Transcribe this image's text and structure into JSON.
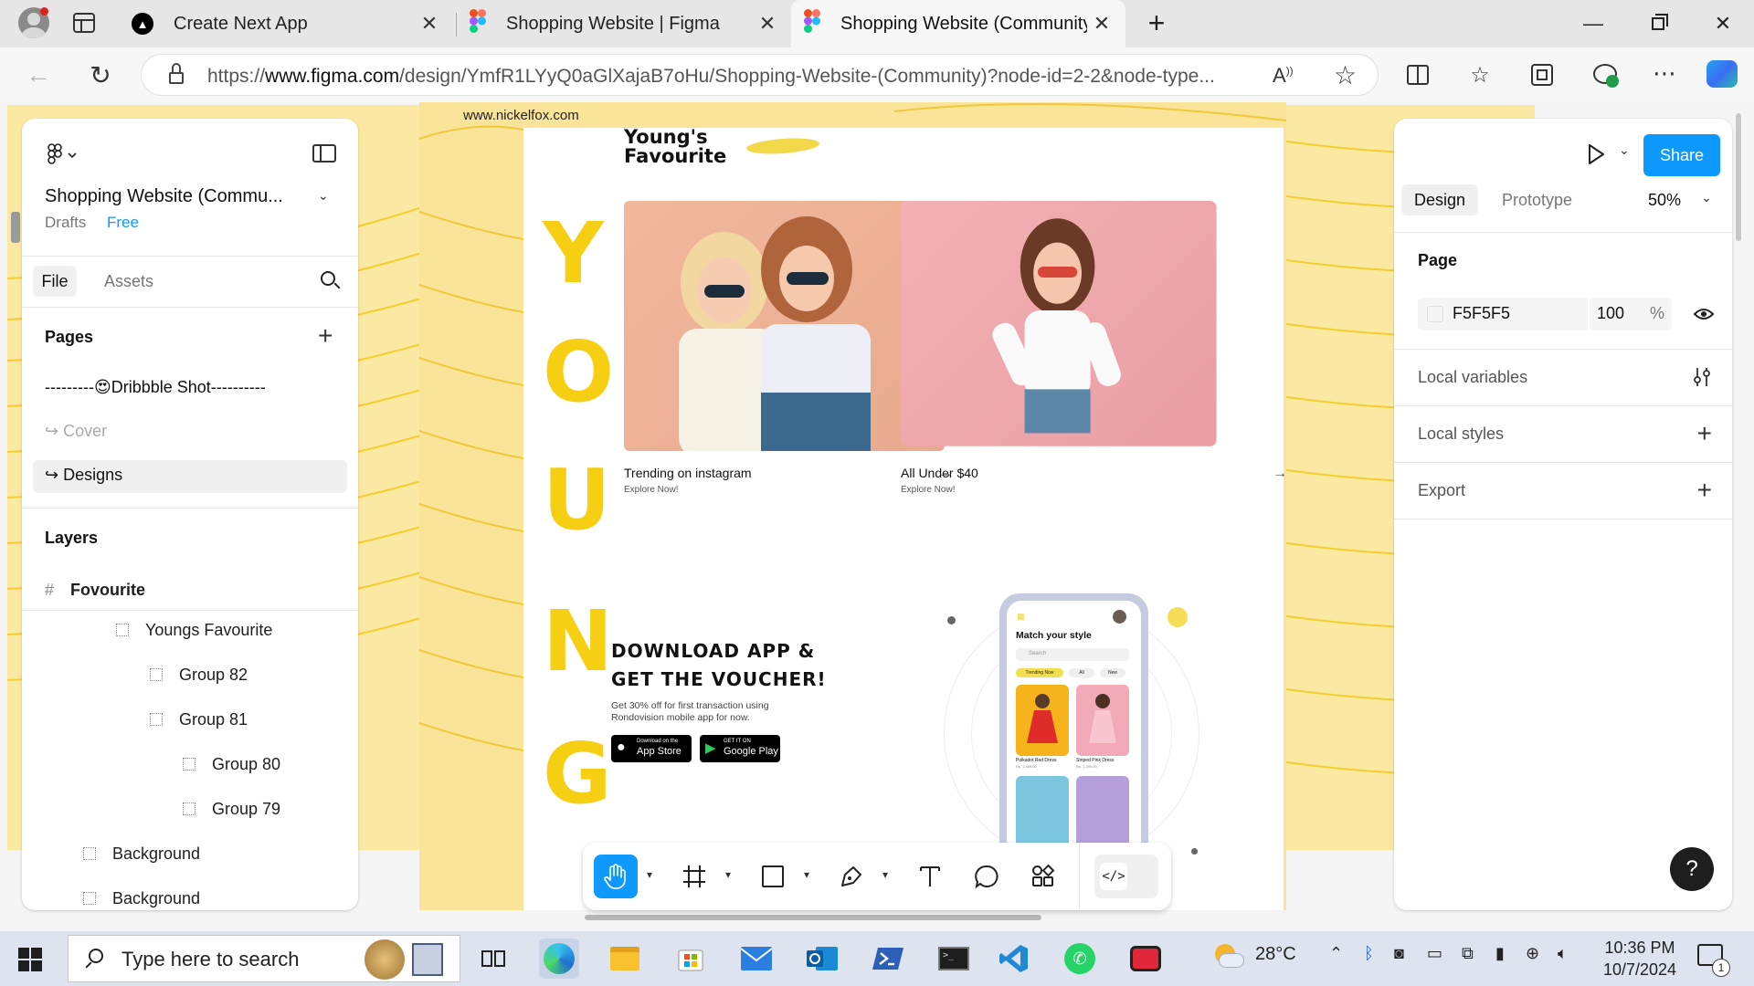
{
  "browser": {
    "tabs": [
      {
        "title": "Create Next App",
        "icon": "nextjs-icon"
      },
      {
        "title": "Shopping Website | Figma",
        "icon": "figma-icon"
      },
      {
        "title": "Shopping Website (Community) –",
        "icon": "figma-icon",
        "active": true
      }
    ],
    "url_prefix": "https://",
    "url_domain": "www.figma.com",
    "url_path": "/design/YmfR1LYyQ0aGlXajaB7oHu/Shopping-Website-(Community)?node-id=2-2&node-type..."
  },
  "left_panel": {
    "file_title": "Shopping Website (Commu...",
    "location": "Drafts",
    "plan": "Free",
    "tab_file": "File",
    "tab_assets": "Assets",
    "pages_label": "Pages",
    "pages": [
      "---------😍Dribbble Shot----------",
      "Cover",
      "Designs"
    ],
    "layers_label": "Layers",
    "layers": [
      {
        "name": "Fovourite",
        "depth": 0,
        "kind": "frame"
      },
      {
        "name": "Youngs Favourite",
        "depth": 1,
        "kind": "group"
      },
      {
        "name": "Group 82",
        "depth": 2,
        "kind": "group"
      },
      {
        "name": "Group 81",
        "depth": 2,
        "kind": "group"
      },
      {
        "name": "Group 80",
        "depth": 3,
        "kind": "group"
      },
      {
        "name": "Group 79",
        "depth": 3,
        "kind": "group"
      },
      {
        "name": "Background",
        "depth": 0,
        "kind": "group"
      },
      {
        "name": "Background",
        "depth": 0,
        "kind": "group"
      }
    ]
  },
  "right_panel": {
    "share_label": "Share",
    "tab_design": "Design",
    "tab_prototype": "Prototype",
    "zoom": "50%",
    "page_label": "Page",
    "page_color": "F5F5F5",
    "page_opacity": "100",
    "percent": "%",
    "local_variables": "Local variables",
    "local_styles": "Local styles",
    "export": "Export",
    "help": "?"
  },
  "design": {
    "site_url": "www.nickelfox.com",
    "heading_line1": "Young's",
    "heading_line2": "Favourite",
    "side_letters": [
      "Y",
      "O",
      "U",
      "N",
      "G"
    ],
    "card1_title": "Trending on instagram",
    "card1_sub": "Explore Now!",
    "card2_title": "All Under $40",
    "card2_sub": "Explore Now!",
    "download_line1": "DOWNLOAD APP &",
    "download_line2": "GET THE VOUCHER!",
    "download_desc_line1": "Get 30% off for first transaction using",
    "download_desc_line2": "Rondovision mobile app for now.",
    "appstore_small": "Download on the",
    "appstore_big": "App Store",
    "googleplay_small": "GET IT ON",
    "googleplay_big": "Google Play",
    "phone_title": "Match your style",
    "phone_search": "Search",
    "phone_chip1": "Trending Now",
    "phone_chip2": "All",
    "phone_chip3": "New",
    "phone_item1": "Polkadot Red Dress",
    "phone_item2": "Striped Pink Dress",
    "phone_price1": "Rs. 1,499.00",
    "phone_price2": "Rs. 1,299.00"
  },
  "taskbar": {
    "search_placeholder": "Type here to search",
    "weather": "28°C",
    "time": "10:36 PM",
    "date": "10/7/2024",
    "notification_count": "1"
  },
  "colors": {
    "figma_blue": "#0d99ff",
    "canvas_yellow": "#fae49a",
    "accent_yellow": "#f6cf12"
  }
}
